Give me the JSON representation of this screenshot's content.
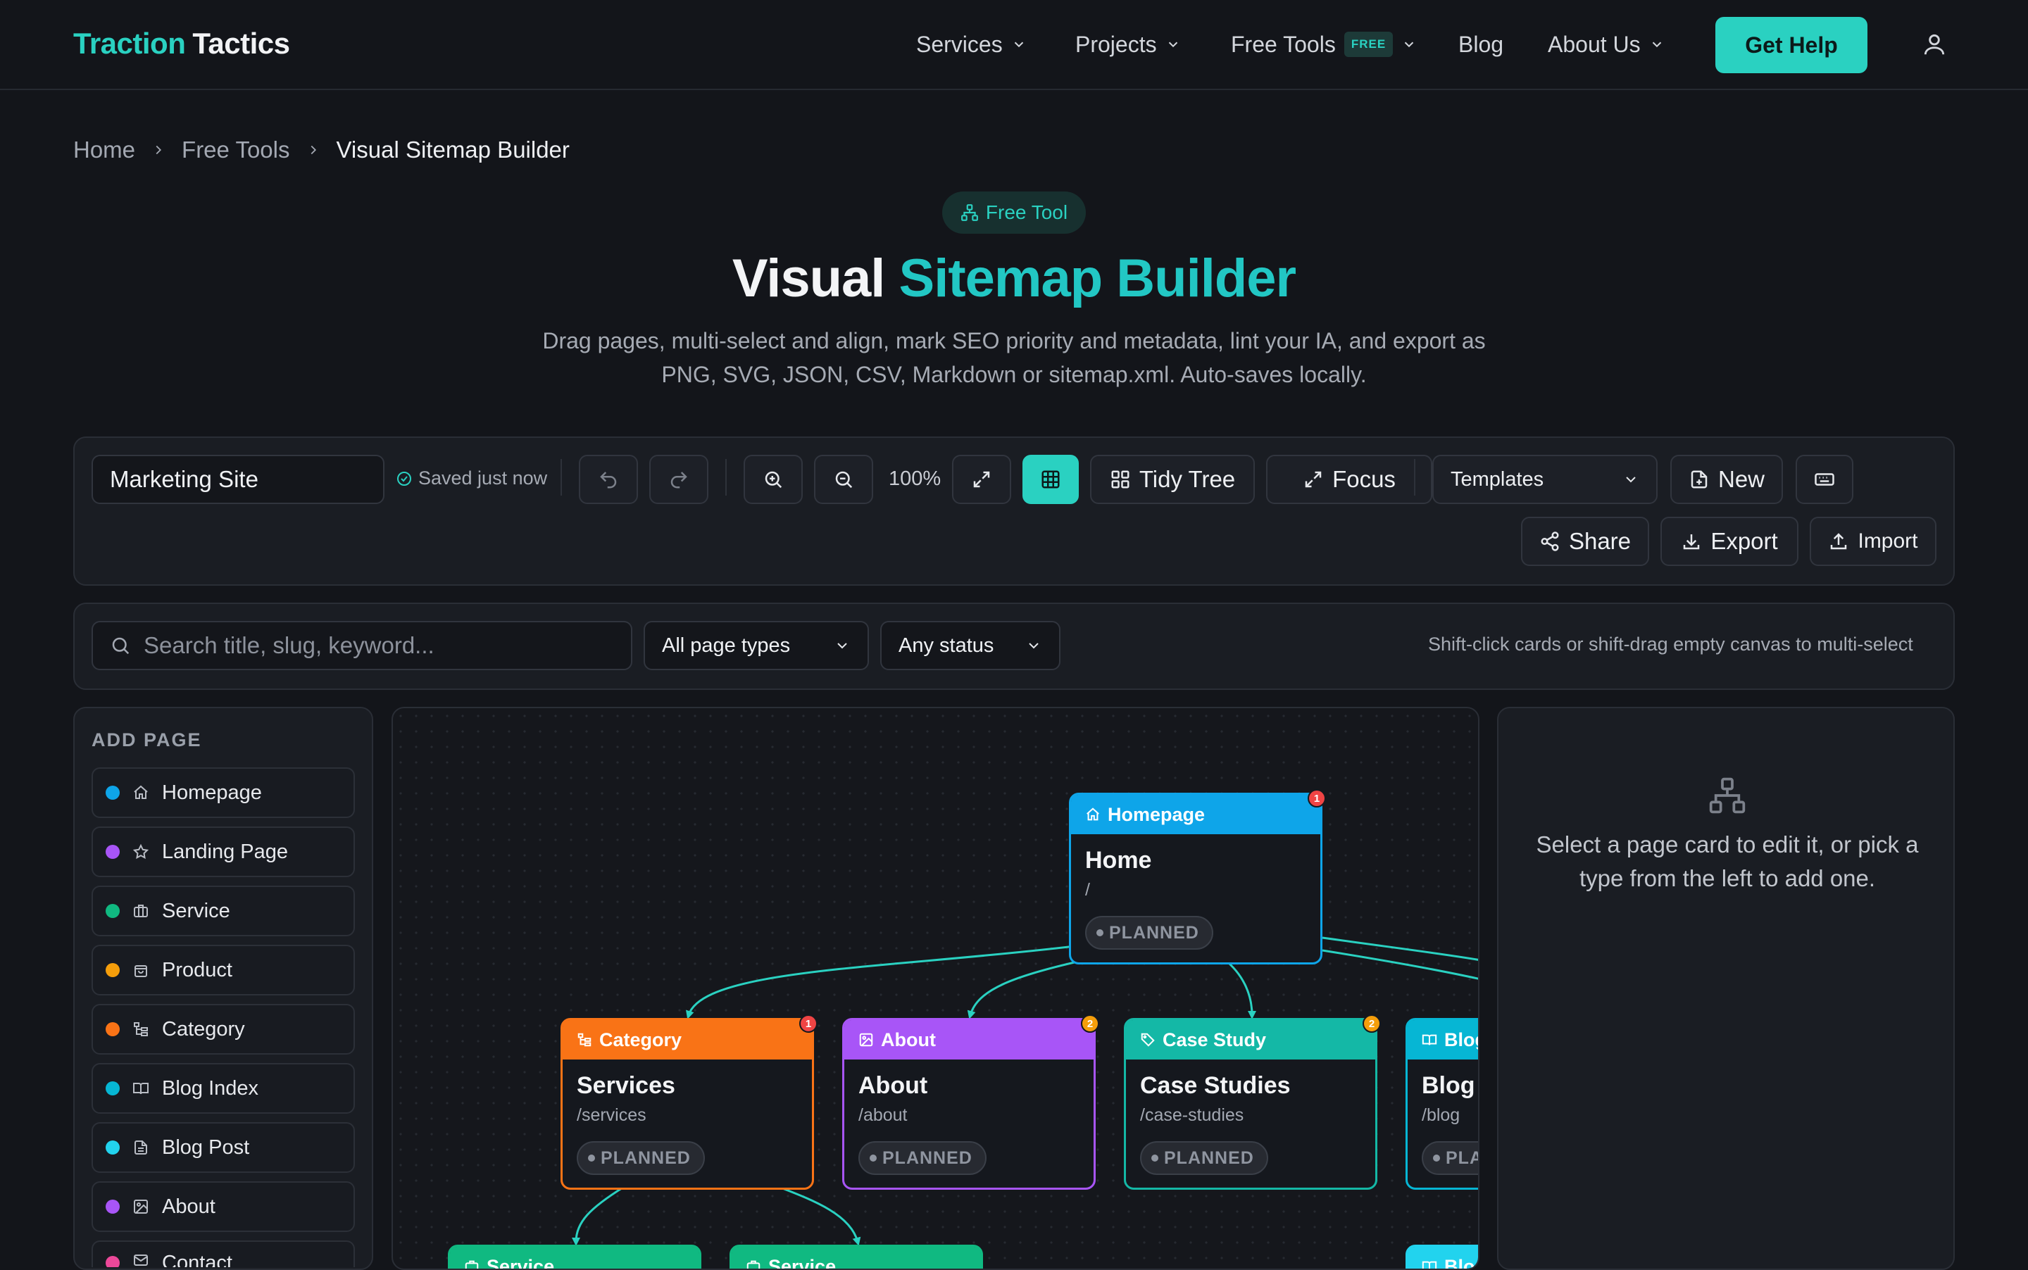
{
  "brand": {
    "part1": "Traction",
    "part2": "Tactics"
  },
  "nav": {
    "services": "Services",
    "projects": "Projects",
    "free_tools": "Free Tools",
    "free_tag": "FREE",
    "blog": "Blog",
    "about": "About Us",
    "get_help": "Get Help"
  },
  "breadcrumb": {
    "home": "Home",
    "free_tools": "Free Tools",
    "current": "Visual Sitemap Builder"
  },
  "hero": {
    "pill": "Free Tool",
    "title_plain": "Visual",
    "title_accent": "Sitemap Builder",
    "subtitle": "Drag pages, multi-select and align, mark SEO priority and metadata, lint your IA, and export as PNG, SVG, JSON, CSV, Markdown or sitemap.xml. Auto-saves locally."
  },
  "toolbar": {
    "project_name": "Marketing Site",
    "saved_status": "Saved just now",
    "zoom": "100%",
    "tidy_tree": "Tidy Tree",
    "focus": "Focus",
    "templates": "Templates",
    "new": "New",
    "share": "Share",
    "export": "Export",
    "import": "Import"
  },
  "filters": {
    "search_placeholder": "Search title, slug, keyword...",
    "page_types": "All page types",
    "status": "Any status",
    "hint": "Shift-click cards or shift-drag empty canvas to multi-select"
  },
  "add_page": {
    "heading": "ADD PAGE",
    "items": [
      {
        "label": "Homepage",
        "color": "#0ea5e9",
        "icon": "home-icon"
      },
      {
        "label": "Landing Page",
        "color": "#a855f7",
        "icon": "star-icon"
      },
      {
        "label": "Service",
        "color": "#10b981",
        "icon": "briefcase-icon"
      },
      {
        "label": "Product",
        "color": "#f59e0b",
        "icon": "shopping-bag-icon"
      },
      {
        "label": "Category",
        "color": "#f97316",
        "icon": "hierarchy-icon"
      },
      {
        "label": "Blog Index",
        "color": "#06b6d4",
        "icon": "book-icon"
      },
      {
        "label": "Blog Post",
        "color": "#22d3ee",
        "icon": "file-text-icon"
      },
      {
        "label": "About",
        "color": "#a855f7",
        "icon": "image-icon"
      },
      {
        "label": "Contact",
        "color": "#ec4899",
        "icon": "mail-icon"
      }
    ]
  },
  "cards": {
    "home": {
      "type": "Homepage",
      "title": "Home",
      "slug": "/",
      "status": "PLANNED",
      "issues": "1",
      "color": "#0ea5e9"
    },
    "services": {
      "type": "Category",
      "title": "Services",
      "slug": "/services",
      "status": "PLANNED",
      "issues": "1",
      "color": "#f97316"
    },
    "about": {
      "type": "About",
      "title": "About",
      "slug": "/about",
      "status": "PLANNED",
      "issues": "2",
      "color": "#a855f7"
    },
    "case_studies": {
      "type": "Case Study",
      "title": "Case Studies",
      "slug": "/case-studies",
      "status": "PLANNED",
      "issues": "2",
      "color": "#14b8a6"
    },
    "blog": {
      "type": "Blog",
      "title": "Blog",
      "slug": "/blog",
      "status": "PLANNED",
      "color": "#06b6d4"
    },
    "service_a": {
      "type": "Service",
      "color": "#10b981"
    },
    "service_b": {
      "type": "Service",
      "color": "#10b981"
    },
    "blog_post": {
      "type": "Blog",
      "color": "#22d3ee"
    }
  },
  "inspector": {
    "empty_message": "Select a page card to edit it, or pick a type from the left to add one."
  }
}
